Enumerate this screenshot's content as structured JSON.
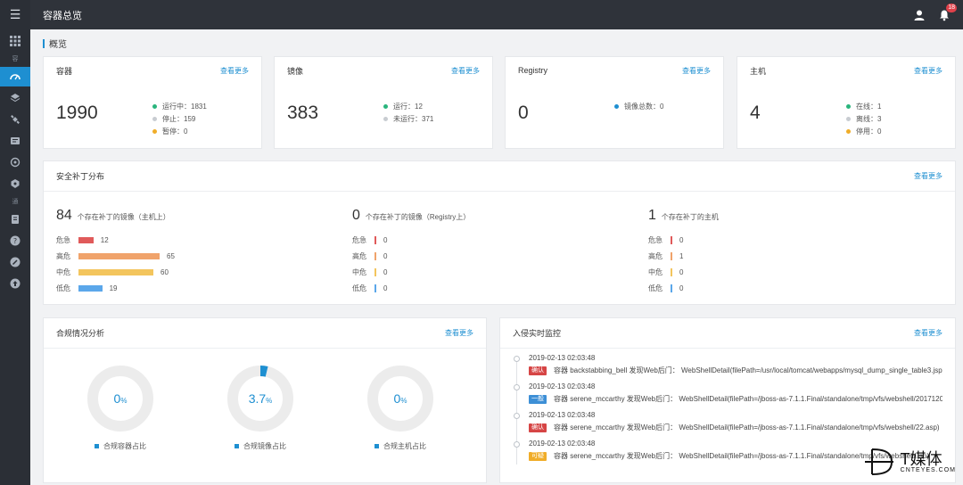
{
  "topbar": {
    "title": "容器总览",
    "notification_count": "18"
  },
  "sidebar": {
    "sep1": "容",
    "sep2": "通"
  },
  "overview": {
    "heading": "概览"
  },
  "cards": [
    {
      "title": "容器",
      "more": "查看更多",
      "value": "1990",
      "stats": [
        {
          "label": "运行中：1831",
          "color": "#2ab57d"
        },
        {
          "label": "停止：159",
          "color": "#c8ccd1"
        },
        {
          "label": "暂停：0",
          "color": "#f0ad29"
        }
      ]
    },
    {
      "title": "镜像",
      "more": "查看更多",
      "value": "383",
      "stats": [
        {
          "label": "运行：12",
          "color": "#2ab57d"
        },
        {
          "label": "未运行：371",
          "color": "#c8ccd1"
        }
      ]
    },
    {
      "title": "Registry",
      "more": "查看更多",
      "value": "0",
      "stats": [
        {
          "label": "镜像总数：0",
          "color": "#1e8fd1"
        }
      ]
    },
    {
      "title": "主机",
      "more": "查看更多",
      "value": "4",
      "stats": [
        {
          "label": "在线：1",
          "color": "#2ab57d"
        },
        {
          "label": "离线：3",
          "color": "#c8ccd1"
        },
        {
          "label": "停用：0",
          "color": "#f0ad29"
        }
      ]
    }
  ],
  "patch": {
    "title": "安全补丁分布",
    "more": "查看更多",
    "columns": [
      {
        "total": "84",
        "desc": "个存在补丁的镜像（主机上）",
        "rows": [
          {
            "label": "危急",
            "value": 12,
            "color": "#e05a5a"
          },
          {
            "label": "高危",
            "value": 65,
            "color": "#f0a36b"
          },
          {
            "label": "中危",
            "value": 60,
            "color": "#f3c55d"
          },
          {
            "label": "低危",
            "value": 19,
            "color": "#5ba7ea"
          }
        ]
      },
      {
        "total": "0",
        "desc": "个存在补丁的镜像（Registry上）",
        "rows": [
          {
            "label": "危急",
            "value": 0,
            "color": "#e05a5a"
          },
          {
            "label": "高危",
            "value": 0,
            "color": "#f0a36b"
          },
          {
            "label": "中危",
            "value": 0,
            "color": "#f3c55d"
          },
          {
            "label": "低危",
            "value": 0,
            "color": "#5ba7ea"
          }
        ]
      },
      {
        "total": "1",
        "desc": "个存在补丁的主机",
        "rows": [
          {
            "label": "危急",
            "value": 0,
            "color": "#e05a5a"
          },
          {
            "label": "高危",
            "value": 1,
            "color": "#f0a36b"
          },
          {
            "label": "中危",
            "value": 0,
            "color": "#f3c55d"
          },
          {
            "label": "低危",
            "value": 0,
            "color": "#5ba7ea"
          }
        ]
      }
    ]
  },
  "compliance": {
    "title": "合规情况分析",
    "more": "查看更多",
    "donuts": [
      {
        "value": "0",
        "unit": "%",
        "fraction": 0,
        "label": "合规容器占比"
      },
      {
        "value": "3.7",
        "unit": "%",
        "fraction": 0.037,
        "label": "合规镜像占比"
      },
      {
        "value": "0",
        "unit": "%",
        "fraction": 0,
        "label": "合规主机占比"
      }
    ]
  },
  "intrusion": {
    "title": "入侵实时监控",
    "more": "查看更多",
    "events": [
      {
        "time": "2019-02-13 02:03:48",
        "tag": "确认",
        "tag_color": "#d64545",
        "msg": "容器 backstabbing_bell 发现Web后门：  WebShellDetail(filePath=/usr/local/tomcat/webapps/mysql_dump_single_table3.jsp)"
      },
      {
        "time": "2019-02-13 02:03:48",
        "tag": "一般",
        "tag_color": "#3d8fd6",
        "msg": "容器 serene_mccarthy 发现Web后门：  WebShellDetail(filePath=/jboss-as-7.1.1.Final/standalone/tmp/vfs/webshell/2017120..."
      },
      {
        "time": "2019-02-13 02:03:48",
        "tag": "确认",
        "tag_color": "#d64545",
        "msg": "容器 serene_mccarthy 发现Web后门：  WebShellDetail(filePath=/jboss-as-7.1.1.Final/standalone/tmp/vfs/webshell/22.asp)"
      },
      {
        "time": "2019-02-13 02:03:48",
        "tag": "可疑",
        "tag_color": "#f0ad29",
        "msg": "容器 serene_mccarthy 发现Web后门：  WebShellDetail(filePath=/jboss-as-7.1.1.Final/standalone/tmp/vfs/webshell/.jsp)"
      }
    ]
  },
  "watermark": {
    "cn": "T媒体",
    "en": "CNTEYES.COM"
  }
}
